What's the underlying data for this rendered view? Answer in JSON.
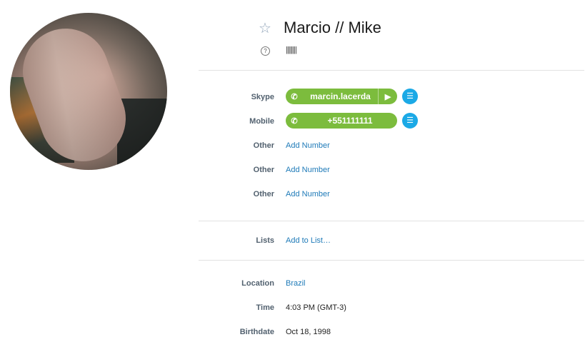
{
  "profile": {
    "name": "Marcio // Mike",
    "mood": "||||||||"
  },
  "contact": {
    "skype_label": "Skype",
    "skype_value": "marcin.lacerda",
    "mobile_label": "Mobile",
    "mobile_value": "+551111111",
    "other_rows": [
      {
        "label": "Other",
        "action": "Add Number"
      },
      {
        "label": "Other",
        "action": "Add Number"
      },
      {
        "label": "Other",
        "action": "Add Number"
      }
    ]
  },
  "lists": {
    "label": "Lists",
    "action": "Add to List…"
  },
  "details": {
    "location_label": "Location",
    "location_value": "Brazil",
    "time_label": "Time",
    "time_value": "4:03 PM (GMT-3)",
    "birthdate_label": "Birthdate",
    "birthdate_value": "Oct 18, 1998"
  },
  "icons": {
    "favorite": "star-icon",
    "mood": "question-icon",
    "phone": "phone-icon",
    "video": "video-icon",
    "chat": "chat-icon"
  },
  "colors": {
    "call_green": "#7cbc3d",
    "chat_blue": "#1ba9e6",
    "link_blue": "#1e7ab8",
    "label_gray": "#52616f"
  }
}
